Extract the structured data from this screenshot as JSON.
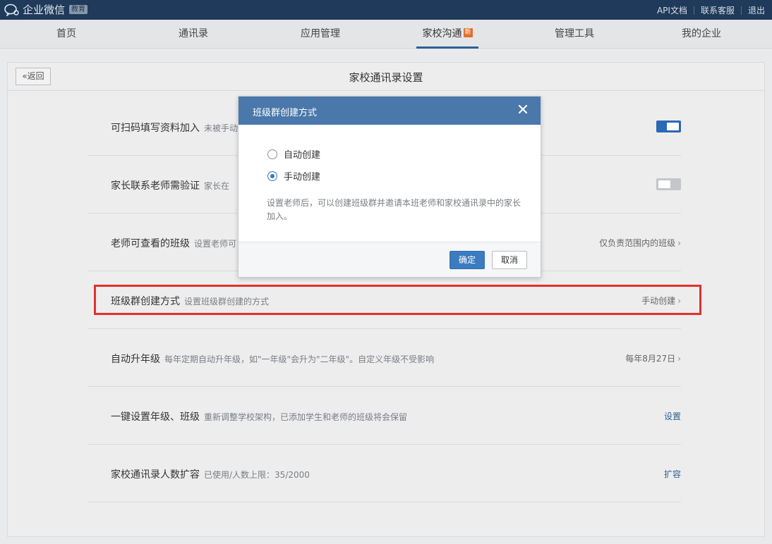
{
  "topbar": {
    "brand": "企业微信",
    "brand_badge": "教育",
    "links": [
      "API文档",
      "联系客服",
      "退出"
    ]
  },
  "nav": {
    "items": [
      "首页",
      "通讯录",
      "应用管理",
      "家校沟通",
      "管理工具",
      "我的企业"
    ],
    "active_index": 3,
    "new_badge": "新"
  },
  "page": {
    "back_label": "返回",
    "title": "家校通讯录设置"
  },
  "settings": [
    {
      "title": "可扫码填写资料加入",
      "desc": "未被手动",
      "control": "toggle",
      "toggle_on": true
    },
    {
      "title": "家长联系老师需验证",
      "desc": "家长在",
      "control": "toggle",
      "toggle_on": false
    },
    {
      "title": "老师可查看的班级",
      "desc": "设置老师可",
      "control": "value",
      "value": "仅负责范围内的班级"
    },
    {
      "title": "班级群创建方式",
      "desc": "设置班级群创建的方式",
      "control": "value",
      "value": "手动创建"
    },
    {
      "title": "自动升年级",
      "desc": "每年定期自动升年级，如\"一年级\"会升为\"二年级\"。自定义年级不受影响",
      "control": "value",
      "value": "每年8月27日"
    },
    {
      "title": "一键设置年级、班级",
      "desc": "重新调整学校架构，已添加学生和老师的班级将会保留",
      "control": "link",
      "value": "设置"
    },
    {
      "title": "家校通讯录人数扩容",
      "desc": "已使用/人数上限：35/2000",
      "control": "link",
      "value": "扩容"
    }
  ],
  "modal": {
    "title": "班级群创建方式",
    "options": [
      "自动创建",
      "手动创建"
    ],
    "selected_index": 1,
    "note": "设置老师后，可以创建班级群并邀请本班老师和家校通讯录中的家长加入。",
    "confirm_label": "确定",
    "cancel_label": "取消"
  },
  "colors": {
    "topbar": "#1f3a5a",
    "accent": "#2a5f93",
    "modal_header": "#4a78ab",
    "highlight": "#e4302a"
  }
}
